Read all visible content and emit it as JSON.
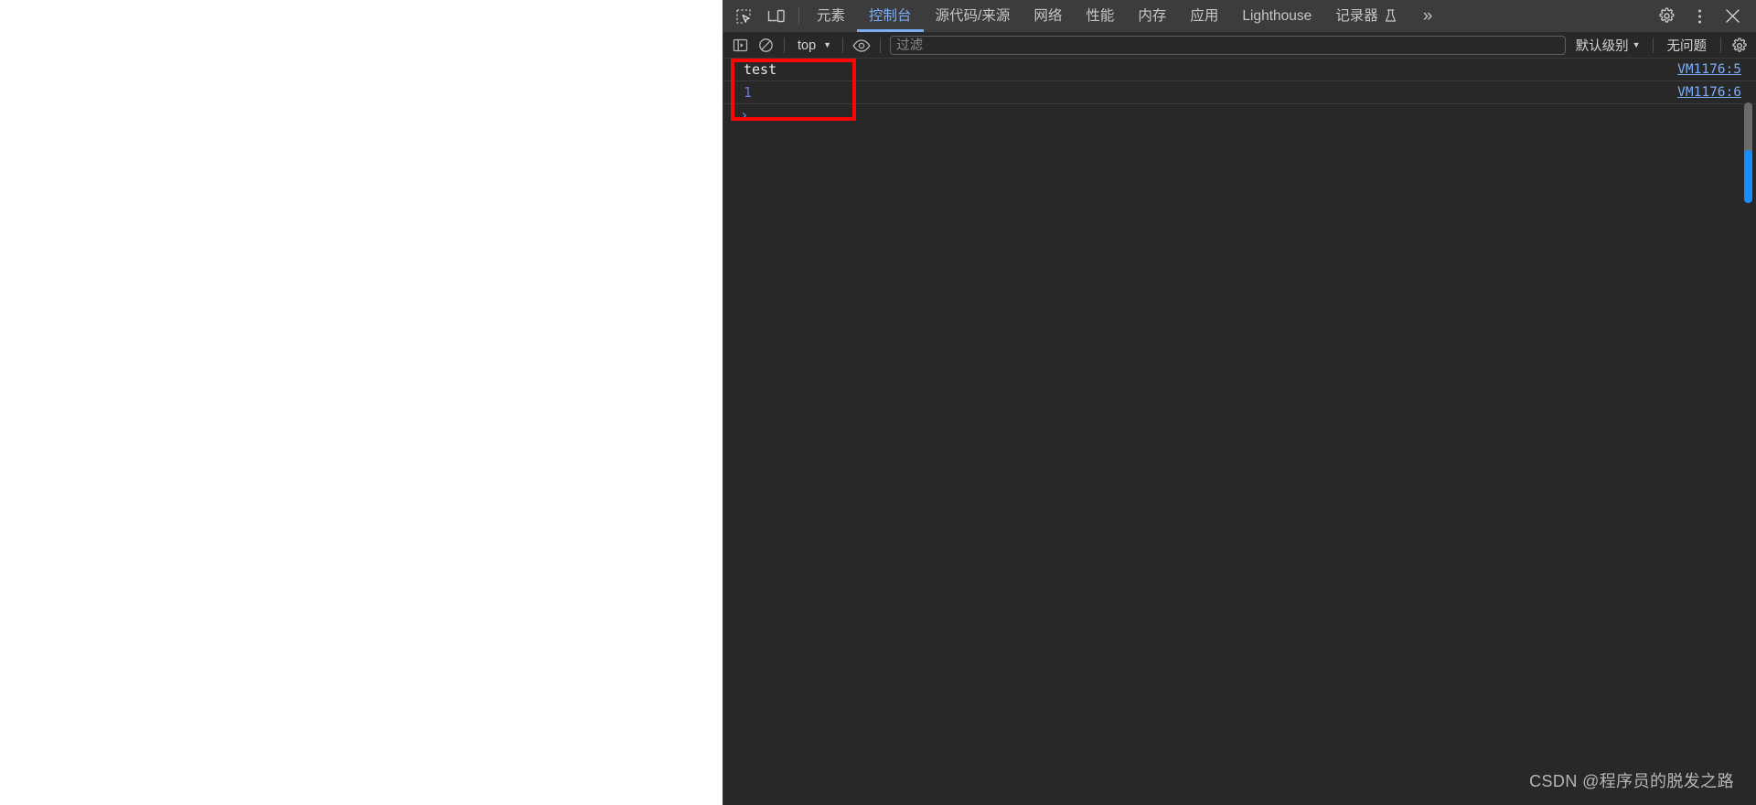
{
  "page": {
    "background_color": "#ffffff"
  },
  "devtools": {
    "background_color": "#282828",
    "accent_color": "#7cacf8",
    "tabstrip": {
      "inspect_icon": "inspect-element-icon",
      "device_toolbar_icon": "device-toolbar-icon",
      "tabs": [
        {
          "label": "元素",
          "active": false
        },
        {
          "label": "控制台",
          "active": true
        },
        {
          "label": "源代码/来源",
          "active": false
        },
        {
          "label": "网络",
          "active": false
        },
        {
          "label": "性能",
          "active": false
        },
        {
          "label": "内存",
          "active": false
        },
        {
          "label": "应用",
          "active": false
        },
        {
          "label": "Lighthouse",
          "active": false
        },
        {
          "label": "记录器",
          "active": false,
          "glyph": "beaker-icon"
        }
      ],
      "overflow_label": "»",
      "settings_icon": "gear-icon",
      "more_icon": "kebab-menu-icon",
      "close_icon": "close-icon"
    },
    "console_toolbar": {
      "sidebar_toggle_icon": "console-sidebar-toggle-icon",
      "clear_console_icon": "clear-console-icon",
      "context_value": "top",
      "context_caret": "▼",
      "live_expression_icon": "eye-icon",
      "filter_placeholder": "过滤",
      "filter_value": "",
      "levels_label": "默认级别",
      "levels_caret": "▼",
      "issues_label": "无问题",
      "settings_icon": "console-settings-gear-icon"
    },
    "console_messages": [
      {
        "text": "test",
        "type": "string",
        "source": "VM1176:5"
      },
      {
        "text": "1",
        "type": "number",
        "source": "VM1176:6"
      }
    ],
    "prompt": {
      "chevron": "›",
      "value": ""
    },
    "scrollbar": {
      "visible": true,
      "thumb_color": "#1a8cff",
      "track_color": "#6b6b6b"
    },
    "annotation": {
      "shape": "rectangle",
      "color": "#fb0606"
    }
  },
  "watermark": {
    "text": "CSDN @程序员的脱发之路"
  }
}
